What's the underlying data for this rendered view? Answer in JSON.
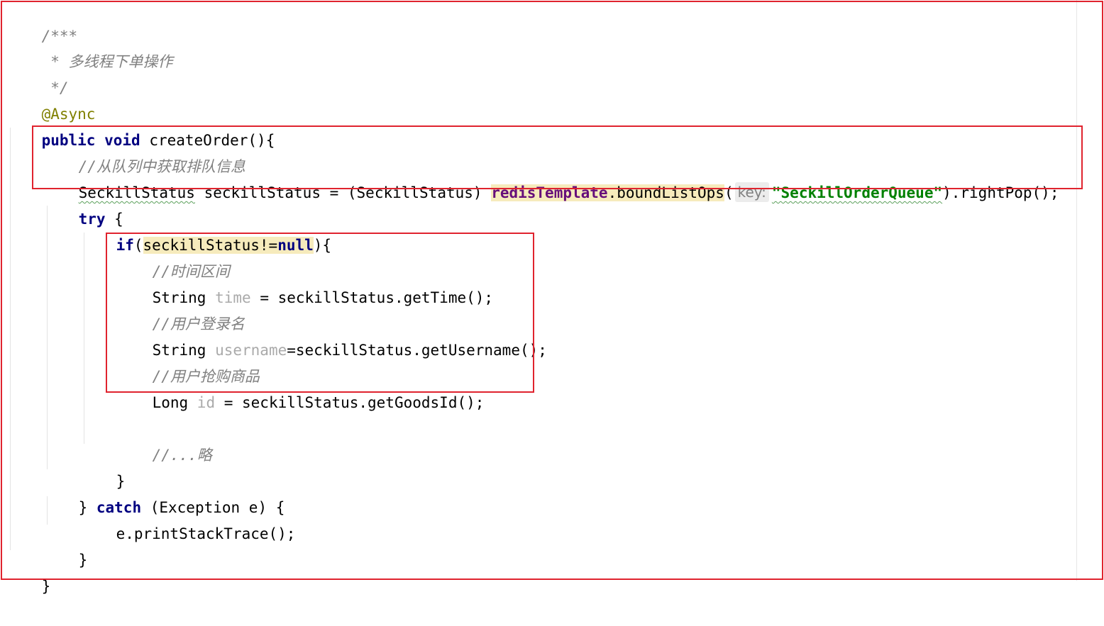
{
  "code": {
    "lines": [
      {
        "id": "doc-open",
        "text": "/***"
      },
      {
        "id": "doc-body",
        "text": " * 多线程下单操作"
      },
      {
        "id": "doc-close",
        "text": " */"
      },
      {
        "id": "annotation",
        "text": "@Async"
      },
      {
        "id": "sig-public",
        "text": "public"
      },
      {
        "id": "sig-void",
        "text": "void"
      },
      {
        "id": "sig-rest",
        "text": "createOrder(){"
      },
      {
        "id": "comment-queue",
        "text": "//从队列中获取排队信息"
      },
      {
        "id": "queue-type",
        "text": "SeckillStatus"
      },
      {
        "id": "queue-decl",
        "text": " seckillStatus = (SeckillStatus) "
      },
      {
        "id": "queue-field",
        "text": "redisTemplate"
      },
      {
        "id": "queue-call",
        "text": ".boundListOps"
      },
      {
        "id": "queue-paren-open",
        "text": "("
      },
      {
        "id": "queue-hint",
        "text": "key:"
      },
      {
        "id": "queue-str",
        "text": "\"SeckillOrderQueue\""
      },
      {
        "id": "queue-tail",
        "text": ").rightPop();"
      },
      {
        "id": "try-kw",
        "text": "try"
      },
      {
        "id": "try-brace",
        "text": " {"
      },
      {
        "id": "if-kw",
        "text": "if"
      },
      {
        "id": "if-paren",
        "text": "("
      },
      {
        "id": "if-cond",
        "text": "seckillStatus!="
      },
      {
        "id": "if-null",
        "text": "null"
      },
      {
        "id": "if-tail",
        "text": "){"
      },
      {
        "id": "comment-time",
        "text": "//时间区间"
      },
      {
        "id": "time-type",
        "text": "String "
      },
      {
        "id": "time-var",
        "text": "time"
      },
      {
        "id": "time-rest",
        "text": " = seckillStatus.getTime();"
      },
      {
        "id": "comment-user",
        "text": "//用户登录名"
      },
      {
        "id": "user-type",
        "text": "String "
      },
      {
        "id": "user-var",
        "text": "username"
      },
      {
        "id": "user-rest",
        "text": "=seckillStatus.getUsername();"
      },
      {
        "id": "comment-goods",
        "text": "//用户抢购商品"
      },
      {
        "id": "goods-type",
        "text": "Long "
      },
      {
        "id": "goods-var",
        "text": "id"
      },
      {
        "id": "goods-rest",
        "text": " = seckillStatus.getGoodsId();"
      },
      {
        "id": "comment-omit",
        "text": "//...略"
      },
      {
        "id": "if-close",
        "text": "}"
      },
      {
        "id": "catch-brace",
        "text": "} "
      },
      {
        "id": "catch-kw",
        "text": "catch"
      },
      {
        "id": "catch-rest",
        "text": " (Exception e) {"
      },
      {
        "id": "print-trace",
        "text": "e.printStackTrace();"
      },
      {
        "id": "try-close",
        "text": "}"
      },
      {
        "id": "method-close",
        "text": "}"
      }
    ]
  },
  "colors": {
    "keyword": "#000080",
    "comment": "#808080",
    "annotation": "#808000",
    "string": "#008000",
    "field": "#660e7a",
    "unused_var": "#aaaaaa",
    "highlight": "#f6ebbc",
    "red_box": "#e0232e"
  }
}
